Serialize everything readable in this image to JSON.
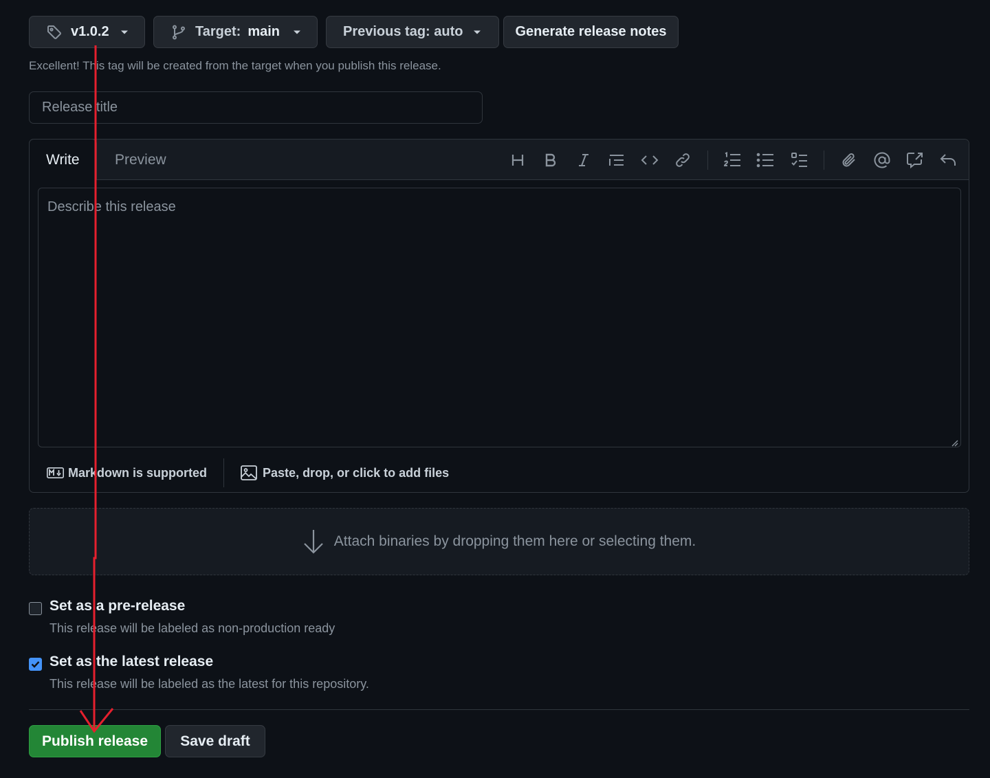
{
  "toolbar": {
    "tag_label": "v1.0.2",
    "target_prefix": "Target:",
    "target_value": "main",
    "previous_tag_label": "Previous tag: auto",
    "generate_notes_label": "Generate release notes"
  },
  "hint_text": "Excellent! This tag will be created from the target when you publish this release.",
  "release_title": {
    "placeholder": "Release title",
    "value": ""
  },
  "editor": {
    "tabs": [
      {
        "label": "Write"
      },
      {
        "label": "Preview"
      }
    ],
    "active_tab": "Write",
    "tools_icons": [
      "heading-icon",
      "bold-icon",
      "italic-icon",
      "quote-icon",
      "code-icon",
      "link-icon",
      "numbered-list-icon",
      "unordered-list-icon",
      "task-list-icon",
      "attach-icon",
      "mention-icon",
      "reference-icon",
      "undo-icon"
    ],
    "body_placeholder": "Describe this release",
    "markdown_note": "Markdown is supported",
    "files_note": "Paste, drop, or click to add files"
  },
  "attach_binaries_text": "Attach binaries by dropping them here or selecting them.",
  "options": {
    "prerelease": {
      "title": "Set as a pre-release",
      "description": "This release will be labeled as non-production ready",
      "checked": false
    },
    "latest": {
      "title": "Set as the latest release",
      "description": "This release will be labeled as the latest for this repository.",
      "checked": true
    }
  },
  "actions": {
    "publish_label": "Publish release",
    "save_draft_label": "Save draft"
  },
  "colors": {
    "background": "#0d1117",
    "publish_green": "#238636",
    "checkbox_blue": "#4493f8",
    "annotation_red": "#e5202e"
  }
}
